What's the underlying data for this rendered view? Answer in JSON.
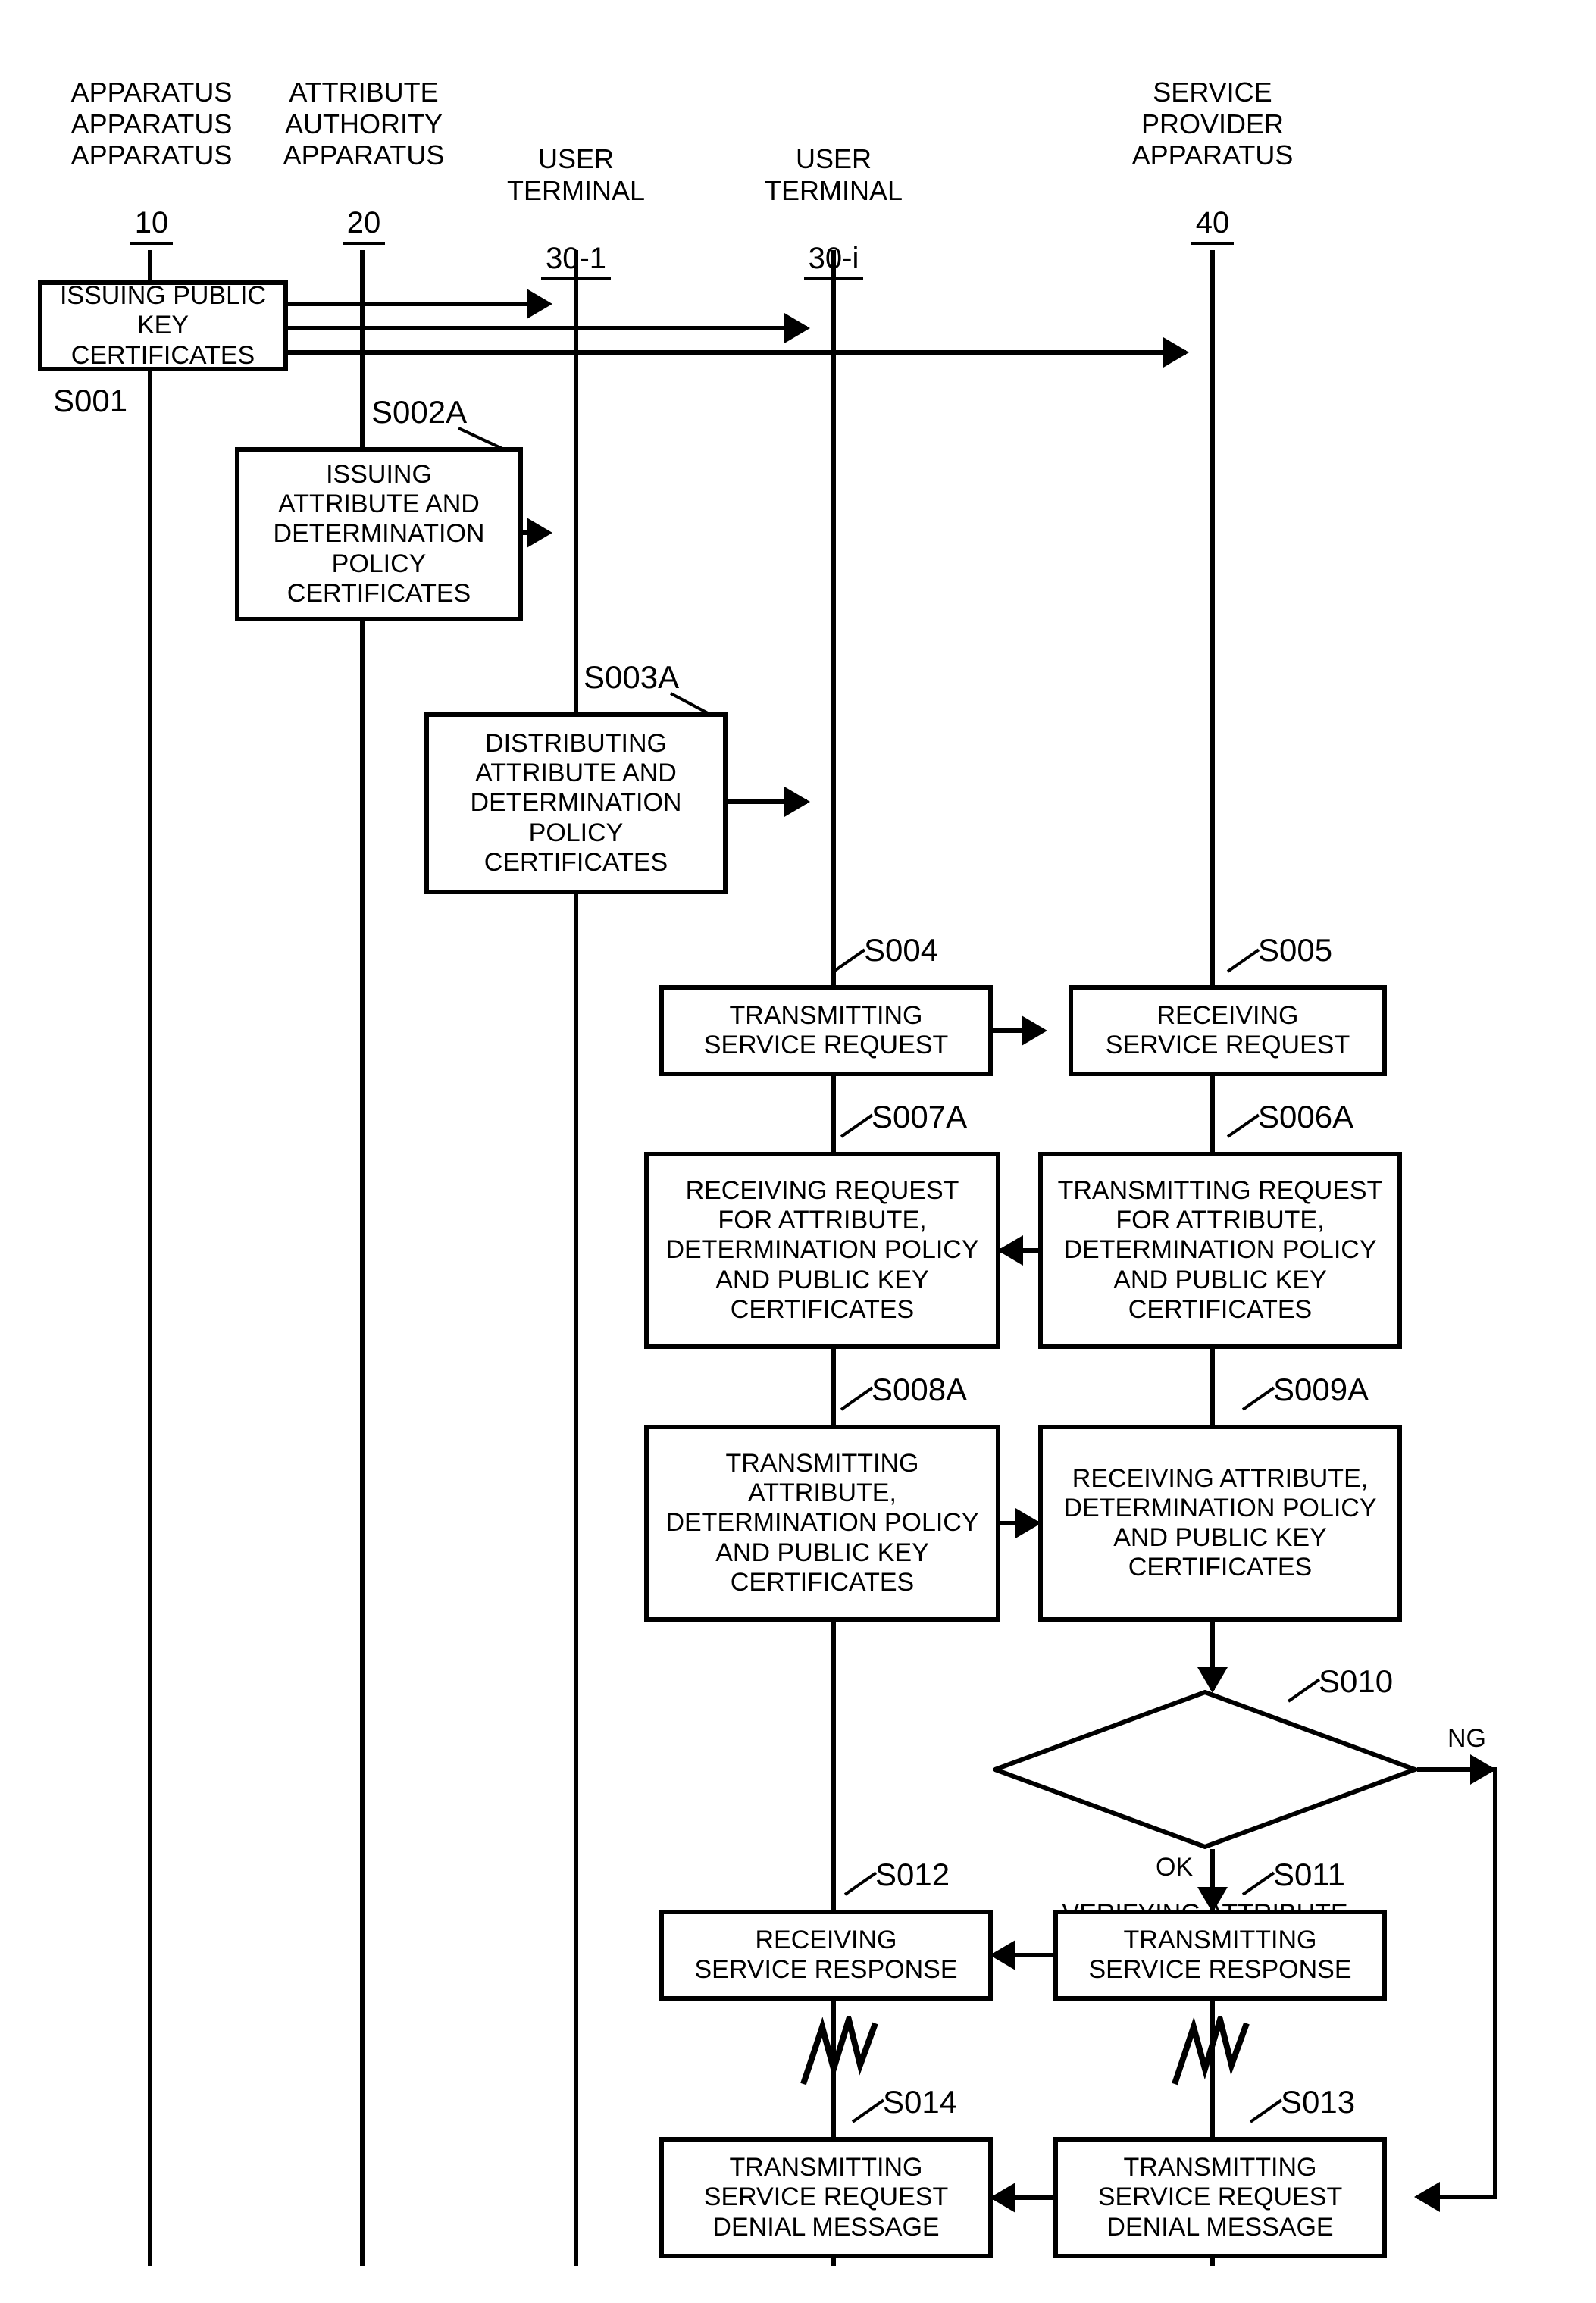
{
  "lanes": {
    "l1": {
      "header": "APPARATUS\nAPPARATUS\nAPPARATUS",
      "num": "10"
    },
    "l2": {
      "header": "ATTRIBUTE\nAUTHORITY\nAPPARATUS",
      "num": "20"
    },
    "l3": {
      "header": "USER TERMINAL",
      "num": "30-1"
    },
    "l4": {
      "header": "USER TERMINAL",
      "num": "30-i"
    },
    "l5": {
      "header": "SERVICE\nPROVIDER\nAPPARATUS",
      "num": "40"
    }
  },
  "steps": {
    "s001": {
      "id": "S001",
      "text": "ISSUING PUBLIC\nKEY CERTIFICATES"
    },
    "s002a": {
      "id": "S002A",
      "text": "ISSUING\nATTRIBUTE AND\nDETERMINATION\nPOLICY CERTIFICATES"
    },
    "s003a": {
      "id": "S003A",
      "text": "DISTRIBUTING\nATTRIBUTE AND\nDETERMINATION\nPOLICY CERTIFICATES"
    },
    "s004": {
      "id": "S004",
      "text": "TRANSMITTING\nSERVICE REQUEST"
    },
    "s005": {
      "id": "S005",
      "text": "RECEIVING\nSERVICE REQUEST"
    },
    "s006a": {
      "id": "S006A",
      "text": "TRANSMITTING REQUEST\nFOR ATTRIBUTE,\nDETERMINATION POLICY\nAND PUBLIC KEY\nCERTIFICATES"
    },
    "s007a": {
      "id": "S007A",
      "text": "RECEIVING REQUEST\nFOR ATTRIBUTE,\nDETERMINATION POLICY\nAND PUBLIC KEY\nCERTIFICATES"
    },
    "s008a": {
      "id": "S008A",
      "text": "TRANSMITTING\nATTRIBUTE,\nDETERMINATION POLICY\nAND PUBLIC KEY\nCERTIFICATES"
    },
    "s009a": {
      "id": "S009A",
      "text": "RECEIVING ATTRIBUTE,\nDETERMINATION POLICY\nAND PUBLIC KEY\nCERTIFICATES"
    },
    "s010": {
      "id": "S010",
      "text": "VERIFYING ATTRIBUTE\nCERTIFICATE"
    },
    "s011": {
      "id": "S011",
      "text": "TRANSMITTING\nSERVICE RESPONSE"
    },
    "s012": {
      "id": "S012",
      "text": "RECEIVING\nSERVICE RESPONSE"
    },
    "s013": {
      "id": "S013",
      "text": "TRANSMITTING\nSERVICE REQUEST\nDENIAL MESSAGE"
    },
    "s014": {
      "id": "S014",
      "text": "TRANSMITTING\nSERVICE REQUEST\nDENIAL MESSAGE"
    }
  },
  "branches": {
    "ok": "OK",
    "ng": "NG"
  }
}
